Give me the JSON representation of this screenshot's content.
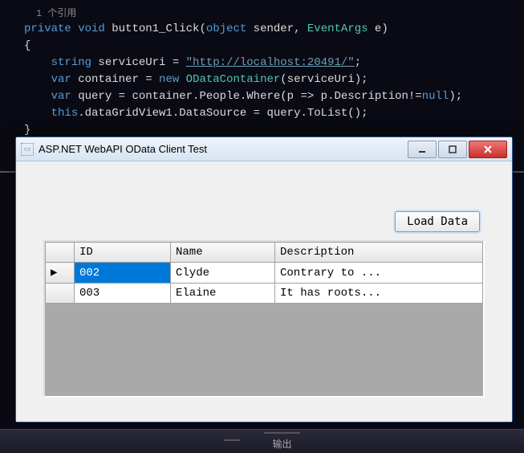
{
  "code": {
    "ref_count": "1 个引用",
    "line1_private": "private",
    "line1_void": "void",
    "line1_method": "button1_Click",
    "line1_object": "object",
    "line1_sender": " sender, ",
    "line1_eventargs": "EventArgs",
    "line1_e": " e)",
    "line2": "{",
    "line3_string": "string",
    "line3_var": " serviceUri = ",
    "line3_url": "\"http://localhost:20491/\"",
    "line3_end": ";",
    "line4_var": "var",
    "line4_mid": " container = ",
    "line4_new": "new",
    "line4_type": " ODataContainer",
    "line4_rest": "(serviceUri);",
    "line5_var": "var",
    "line5_mid": " query = container.People.Where(p => p.Description!=",
    "line5_null": "null",
    "line5_end": ");",
    "line6_this": "this",
    "line6_rest": ".dataGridView1.DataSource = query.ToList();",
    "line7": "}"
  },
  "window": {
    "title": "ASP.NET WebAPI OData Client Test",
    "load_button": "Load Data"
  },
  "grid": {
    "headers": {
      "id": "ID",
      "name": "Name",
      "desc": "Description"
    },
    "rows": [
      {
        "id": "002",
        "name": "Clyde",
        "desc": "Contrary to ..."
      },
      {
        "id": "003",
        "name": "Elaine",
        "desc": "It has roots..."
      }
    ]
  },
  "bottom": {
    "a": "",
    "b": "输出"
  }
}
